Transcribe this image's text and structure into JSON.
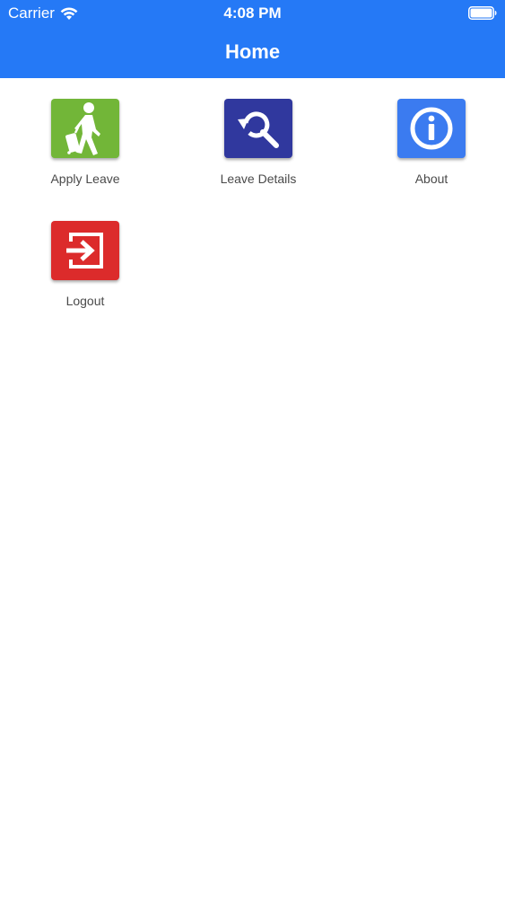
{
  "status_bar": {
    "carrier": "Carrier",
    "time": "4:08 PM"
  },
  "header": {
    "title": "Home"
  },
  "colors": {
    "header_bg": "#2579f6",
    "apply_leave": "#72b638",
    "leave_details": "#30389e",
    "about": "#3b7bf0",
    "logout": "#dc2b2b"
  },
  "menu": [
    {
      "label": "Apply Leave",
      "icon": "walking-traveler-icon"
    },
    {
      "label": "Leave Details",
      "icon": "history-search-icon"
    },
    {
      "label": "About",
      "icon": "info-icon"
    },
    {
      "label": "Logout",
      "icon": "logout-icon"
    }
  ]
}
